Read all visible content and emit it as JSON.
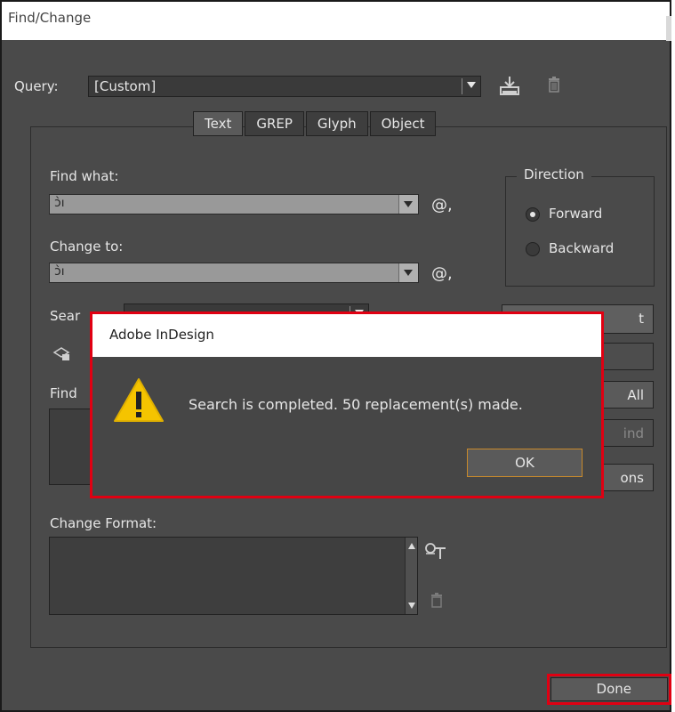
{
  "window": {
    "title": "Find/Change"
  },
  "query": {
    "label": "Query:",
    "value": "[Custom]"
  },
  "tabs": [
    {
      "label": "Text",
      "active": true
    },
    {
      "label": "GREP",
      "active": false
    },
    {
      "label": "Glyph",
      "active": false
    },
    {
      "label": "Object",
      "active": false
    }
  ],
  "find": {
    "label": "Find what:",
    "value": "ↄ̀ו",
    "special_glyph": "@,"
  },
  "change": {
    "label": "Change to:",
    "value": "ↄ̀ו",
    "special_glyph": "@,"
  },
  "search": {
    "label_visible": "Sear"
  },
  "find_format": {
    "label_visible": "Find"
  },
  "change_format": {
    "label": "Change Format:"
  },
  "direction": {
    "legend": "Direction",
    "options": [
      {
        "label": "Forward",
        "selected": true
      },
      {
        "label": "Backward",
        "selected": false
      }
    ]
  },
  "right_buttons": {
    "b1": "t",
    "b2": "",
    "b3": "All",
    "b4": "ind",
    "b5": "ons"
  },
  "done_label": "Done",
  "alert": {
    "title": "Adobe InDesign",
    "message": "Search is completed.  50 replacement(s) made.",
    "ok_label": "OK"
  },
  "colors": {
    "dialog_bg": "#4a4a4a",
    "highlight_red": "#e00012",
    "warning_yellow": "#f5c400",
    "ok_border": "#c98a2b"
  }
}
